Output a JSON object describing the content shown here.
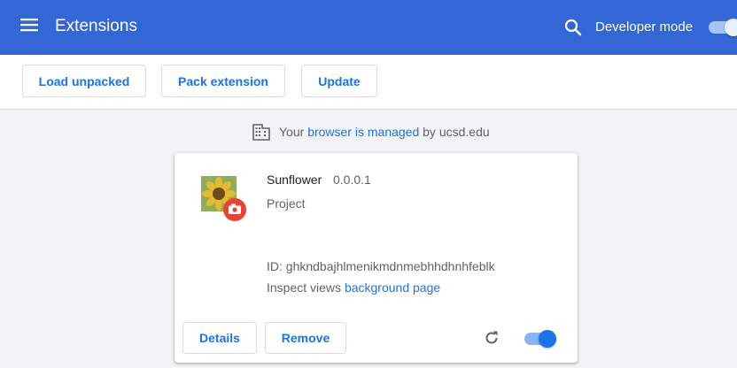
{
  "header": {
    "title": "Extensions",
    "developer_mode_label": "Developer mode",
    "developer_mode_on": true,
    "menu_icon": "hamburger-menu-icon",
    "search_icon": "search-icon"
  },
  "toolbar": {
    "load_unpacked": "Load unpacked",
    "pack_extension": "Pack extension",
    "update": "Update"
  },
  "managed_notice": {
    "icon": "building-icon",
    "prefix": "Your",
    "link": "browser is managed",
    "suffix": "by ucsd.edu"
  },
  "extension": {
    "name": "Sunflower",
    "version": "0.0.0.1",
    "description": "Project",
    "id_text": "ID: ghkndbajhlmenikmdnmebhhdhnhfeblk",
    "inspect_label": "Inspect views",
    "inspect_link": "background page",
    "details_label": "Details",
    "remove_label": "Remove",
    "enabled": true,
    "reload_icon": "reload-icon"
  },
  "colors": {
    "header_bg": "#3367d6",
    "accent": "#1a73e8",
    "page_bg": "#f1f3f4",
    "badge": "#ea4335"
  }
}
